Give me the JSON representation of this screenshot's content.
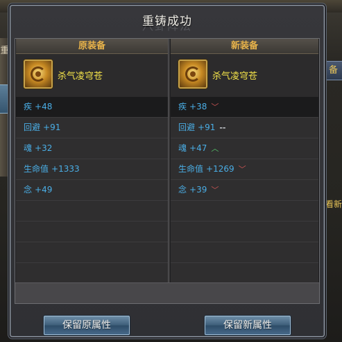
{
  "dialog": {
    "title": "重铸成功",
    "title_watermark": "八卦阵法"
  },
  "background": {
    "left_label": "重",
    "right_tab_label": "备",
    "right_text": "看新"
  },
  "original": {
    "header": "原装备",
    "item_name": "杀气凌穹苍",
    "item_icon": "gold-emblem-icon",
    "stats": [
      {
        "name": "疾",
        "value": "+48"
      },
      {
        "name": "回避",
        "value": "+91"
      },
      {
        "name": "魂",
        "value": "+32"
      },
      {
        "name": "生命值",
        "value": "+1333"
      },
      {
        "name": "念",
        "value": "+49"
      }
    ]
  },
  "new": {
    "header": "新装备",
    "item_name": "杀气凌穹苍",
    "item_icon": "gold-emblem-icon",
    "stats": [
      {
        "name": "疾",
        "value": "+38",
        "trend": "﹀",
        "trend_type": "down"
      },
      {
        "name": "回避",
        "value": "+91",
        "trend": "--",
        "trend_type": "same"
      },
      {
        "name": "魂",
        "value": "+47",
        "trend": "︿",
        "trend_type": "up"
      },
      {
        "name": "生命值",
        "value": "+1269",
        "trend": "﹀",
        "trend_type": "down"
      },
      {
        "name": "念",
        "value": "+39",
        "trend": "﹀",
        "trend_type": "down"
      }
    ]
  },
  "buttons": {
    "keep_old": "保留原属性",
    "keep_new": "保留新属性"
  },
  "colors": {
    "header_gold": "#e8b34a",
    "item_name_yellow": "#f5e44a",
    "stat_blue": "#4aaee6",
    "trend_down": "#c95454",
    "trend_up": "#55c26a"
  }
}
